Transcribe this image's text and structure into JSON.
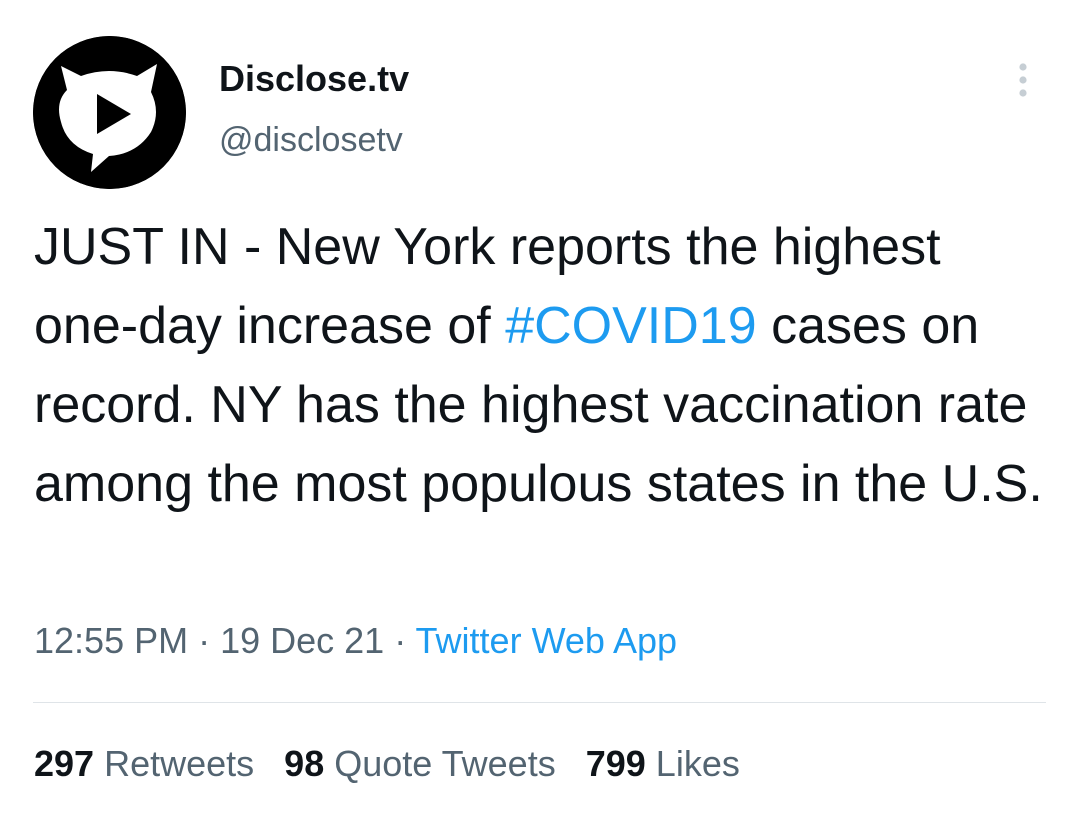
{
  "author": {
    "display_name": "Disclose.tv",
    "handle": "@disclosetv"
  },
  "tweet": {
    "text_part1": "JUST IN - New York reports the highest one-day increase of ",
    "hashtag": "#COVID19",
    "text_part2": " cases on record. NY has the highest vaccination rate among the most populous states in the U.S."
  },
  "meta": {
    "time": "12:55 PM",
    "separator1": " · ",
    "date": "19 Dec 21",
    "separator2": " · ",
    "source": "Twitter Web App"
  },
  "stats": {
    "retweets_count": "297",
    "retweets_label": "Retweets",
    "quotes_count": "98",
    "quotes_label": "Quote Tweets",
    "likes_count": "799",
    "likes_label": "Likes"
  },
  "colors": {
    "link": "#1d9bf0",
    "secondary_text": "#536471",
    "primary_text": "#0f1419",
    "avatar_bg": "#000000"
  },
  "icons": {
    "avatar": "play-speech-bubble-logo-icon",
    "more": "more-dots-vertical-icon"
  }
}
